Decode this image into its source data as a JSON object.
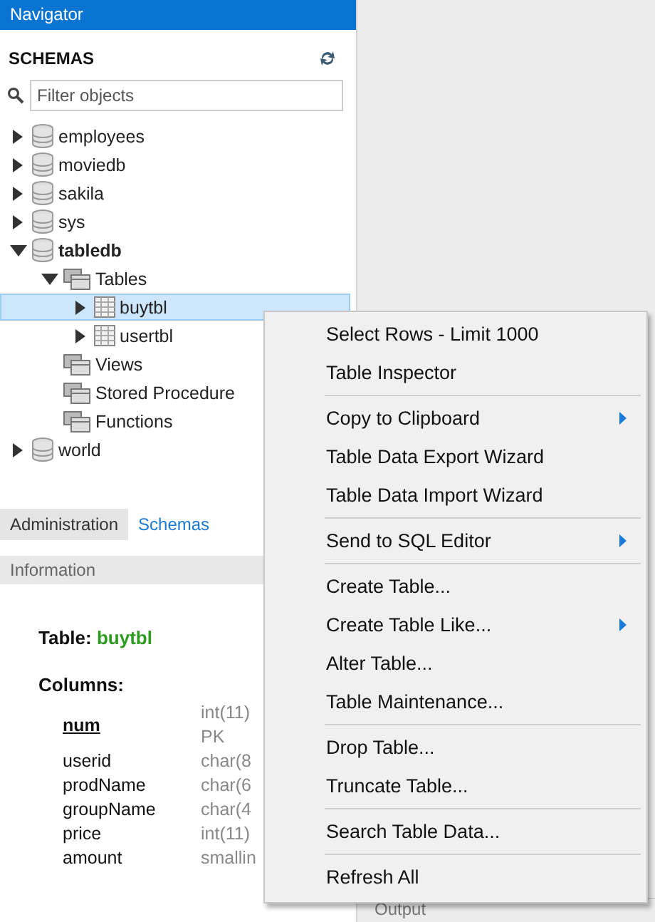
{
  "navigator": {
    "title": "Navigator"
  },
  "schemas": {
    "title": "SCHEMAS",
    "filter_placeholder": "Filter objects"
  },
  "tree": [
    {
      "label": "employees",
      "kind": "schema",
      "expanded": false,
      "selected": false,
      "active": false
    },
    {
      "label": "moviedb",
      "kind": "schema",
      "expanded": false,
      "selected": false,
      "active": false
    },
    {
      "label": "sakila",
      "kind": "schema",
      "expanded": false,
      "selected": false,
      "active": false
    },
    {
      "label": "sys",
      "kind": "schema",
      "expanded": false,
      "selected": false,
      "active": false
    },
    {
      "label": "tabledb",
      "kind": "schema",
      "expanded": true,
      "selected": false,
      "active": true,
      "children": [
        {
          "label": "Tables",
          "kind": "folder",
          "expanded": true,
          "selected": false,
          "active": false,
          "children": [
            {
              "label": "buytbl",
              "kind": "table",
              "expanded": false,
              "selected": true,
              "active": false
            },
            {
              "label": "usertbl",
              "kind": "table",
              "expanded": false,
              "selected": false,
              "active": false
            }
          ]
        },
        {
          "label": "Views",
          "kind": "folder",
          "selected": false,
          "active": false
        },
        {
          "label": "Stored Procedure",
          "kind": "folder",
          "selected": false,
          "active": false
        },
        {
          "label": "Functions",
          "kind": "folder",
          "selected": false,
          "active": false
        }
      ]
    },
    {
      "label": "world",
      "kind": "schema",
      "expanded": false,
      "selected": false,
      "active": false
    }
  ],
  "tabs": [
    {
      "label": "Administration",
      "selected": false
    },
    {
      "label": "Schemas",
      "selected": true
    }
  ],
  "information": {
    "title": "Information",
    "table_label": "Table:",
    "table_name": "buytbl",
    "columns_label": "Columns:",
    "columns": [
      {
        "name": "num",
        "type": "int(11)",
        "primary": true,
        "note": "PK"
      },
      {
        "name": "userid",
        "type": "char(8",
        "primary": false
      },
      {
        "name": "prodName",
        "type": "char(6",
        "primary": false
      },
      {
        "name": "groupName",
        "type": "char(4",
        "primary": false
      },
      {
        "name": "price",
        "type": "int(11)",
        "primary": false
      },
      {
        "name": "amount",
        "type": "smallin",
        "primary": false
      }
    ]
  },
  "context_menu": {
    "groups": [
      [
        {
          "label": "Select Rows - Limit 1000",
          "submenu": false
        },
        {
          "label": "Table Inspector",
          "submenu": false
        }
      ],
      [
        {
          "label": "Copy to Clipboard",
          "submenu": true
        },
        {
          "label": "Table Data Export Wizard",
          "submenu": false
        },
        {
          "label": "Table Data Import Wizard",
          "submenu": false
        }
      ],
      [
        {
          "label": "Send to SQL Editor",
          "submenu": true
        }
      ],
      [
        {
          "label": "Create Table...",
          "submenu": false
        },
        {
          "label": "Create Table Like...",
          "submenu": true
        },
        {
          "label": "Alter Table...",
          "submenu": false
        },
        {
          "label": "Table Maintenance...",
          "submenu": false
        }
      ],
      [
        {
          "label": "Drop Table...",
          "submenu": false
        },
        {
          "label": "Truncate Table...",
          "submenu": false
        }
      ],
      [
        {
          "label": "Search Table Data...",
          "submenu": false
        }
      ],
      [
        {
          "label": "Refresh All",
          "submenu": false
        }
      ]
    ]
  },
  "output": {
    "title": "Output"
  }
}
